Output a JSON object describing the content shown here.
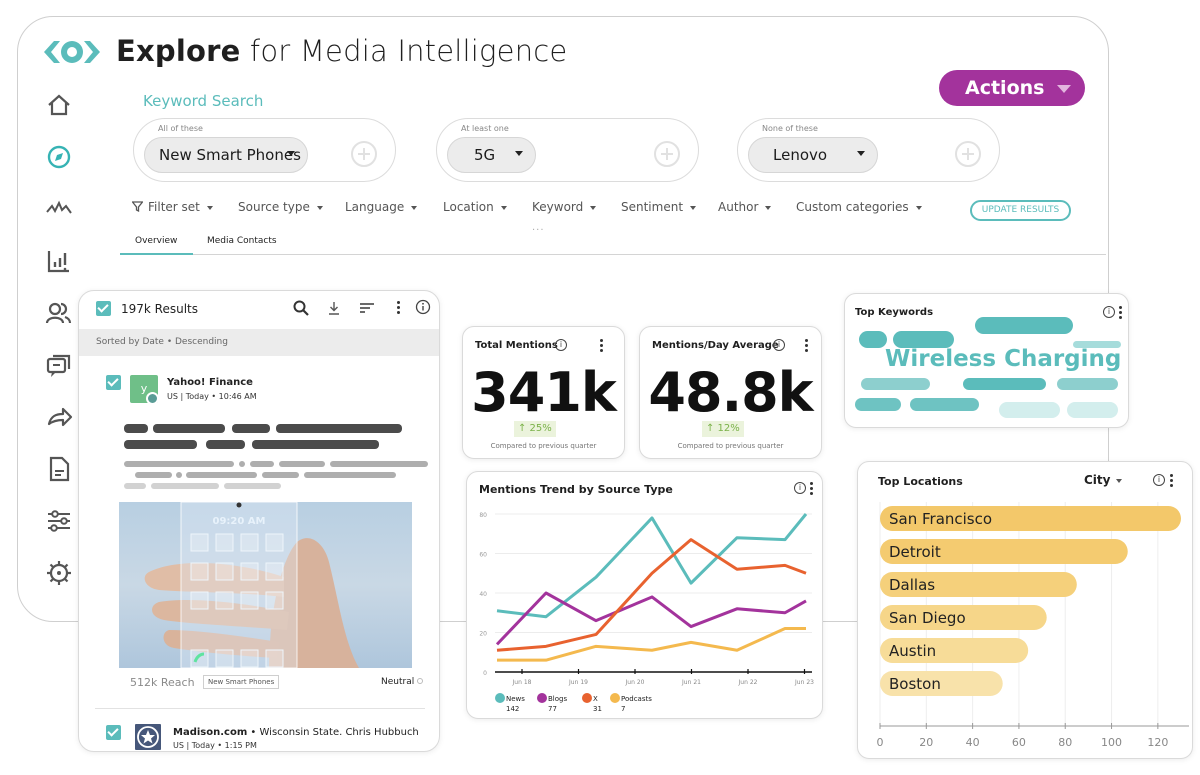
{
  "app": {
    "title_bold": "Explore",
    "title_rest": " for Media Intelligence",
    "actions_label": "Actions"
  },
  "sidebar": {
    "items": [
      {
        "name": "home",
        "icon": "home-icon"
      },
      {
        "name": "explore",
        "icon": "compass-icon",
        "active": true
      },
      {
        "name": "monitor",
        "icon": "pulse-icon"
      },
      {
        "name": "analyze",
        "icon": "bar-chart-icon"
      },
      {
        "name": "contacts",
        "icon": "people-icon"
      },
      {
        "name": "engage",
        "icon": "chat-icon"
      },
      {
        "name": "share",
        "icon": "share-arrow-icon"
      },
      {
        "name": "reports",
        "icon": "document-icon"
      },
      {
        "name": "filters",
        "icon": "sliders-icon"
      },
      {
        "name": "settings",
        "icon": "gear-icon"
      }
    ]
  },
  "keyword_search": {
    "label": "Keyword Search",
    "groups": [
      {
        "caption": "All of these",
        "value": "New Smart Phones"
      },
      {
        "caption": "At least one",
        "value": "5G"
      },
      {
        "caption": "None of these",
        "value": "Lenovo"
      }
    ]
  },
  "filters": {
    "items": [
      "Filter set",
      "Source type",
      "Language",
      "Location",
      "Keyword",
      "Sentiment",
      "Author",
      "Custom categories"
    ],
    "update_label": "UPDATE RESULTS",
    "more": "..."
  },
  "tabs": [
    {
      "label": "Overview",
      "active": true
    },
    {
      "label": "Media Contacts",
      "active": false
    }
  ],
  "results": {
    "count_label": "197k Results",
    "sorted_label": "Sorted by Date • Descending",
    "items": [
      {
        "avatar_letter": "y",
        "source": "Yahoo! Finance",
        "meta": "US | Today • 10:46 AM",
        "reach": "512k Reach",
        "tag": "New Smart Phones",
        "sentiment": "Neutral",
        "image_clock": "09:20 AM"
      },
      {
        "source": "Madison.com",
        "author": " • Wisconsin State. Chris Hubbuch",
        "meta": "US | Today • 1:15 PM"
      }
    ]
  },
  "stats": {
    "total_mentions": {
      "title": "Total Mentions",
      "value": "341k",
      "delta": "↑ 25%",
      "compare": "Compared to previous quarter"
    },
    "mentions_per_day": {
      "title": "Mentions/Day Average",
      "value": "48.8k",
      "delta": "↑ 12%",
      "compare": "Compared to previous quarter"
    }
  },
  "top_keywords": {
    "title": "Top Keywords",
    "featured": "Wireless Charging"
  },
  "top_locations": {
    "title": "Top Locations",
    "select": "City"
  },
  "colors": {
    "teal": "#5bbcbb",
    "purple": "#a3339c",
    "orange": "#e8622f",
    "yellow": "#f4b94e",
    "bar_gold": "#f3ca6b"
  },
  "chart_data": [
    {
      "type": "line",
      "title": "Mentions Trend by Source Type",
      "x": [
        "Jun 17.5",
        "Jun 18.4",
        "Jun 19.3",
        "Jun 20.1",
        "Jun 21",
        "Jun 21.8",
        "Jun 22.6",
        "Jun 23"
      ],
      "x_ticks": [
        "Jun 18",
        "Jun 19",
        "Jun 20",
        "Jun 21",
        "Jun 22",
        "Jun 23"
      ],
      "x_positions": [
        0,
        0.9,
        1.8,
        2.6,
        3.5,
        4.3,
        5.1,
        5.5
      ],
      "ylim": [
        0,
        80
      ],
      "y_ticks": [
        0,
        20,
        40,
        60,
        80
      ],
      "grid": true,
      "legend": "bottom-left",
      "series": [
        {
          "name": "News",
          "total": 142,
          "color": "#5bbcbb",
          "values": [
            31,
            28,
            48,
            78,
            45,
            68,
            67,
            80
          ]
        },
        {
          "name": "Blogs",
          "total": 77,
          "color": "#a3339c",
          "values": [
            14,
            40,
            26,
            38,
            23,
            32,
            30,
            36
          ]
        },
        {
          "name": "X",
          "total": 31,
          "color": "#e8622f",
          "values": [
            11,
            13,
            19,
            50,
            67,
            52,
            54,
            50
          ]
        },
        {
          "name": "Podcasts",
          "total": 7,
          "color": "#f4b94e",
          "values": [
            6,
            6,
            13,
            11,
            15,
            11,
            22,
            22
          ]
        }
      ],
      "series_x_index": [
        0,
        0.55,
        1.1,
        1.65,
        2.2,
        2.75,
        3.3,
        3.6
      ]
    },
    {
      "type": "bar",
      "orientation": "horizontal",
      "title": "Top Locations",
      "categories": [
        "San Francisco",
        "Detroit",
        "Dallas",
        "San Diego",
        "Austin",
        "Boston"
      ],
      "values": [
        130,
        107,
        85,
        72,
        64,
        53
      ],
      "xlim": [
        0,
        130
      ],
      "x_ticks": [
        0,
        20,
        40,
        60,
        80,
        100,
        120
      ],
      "grid": true
    }
  ]
}
